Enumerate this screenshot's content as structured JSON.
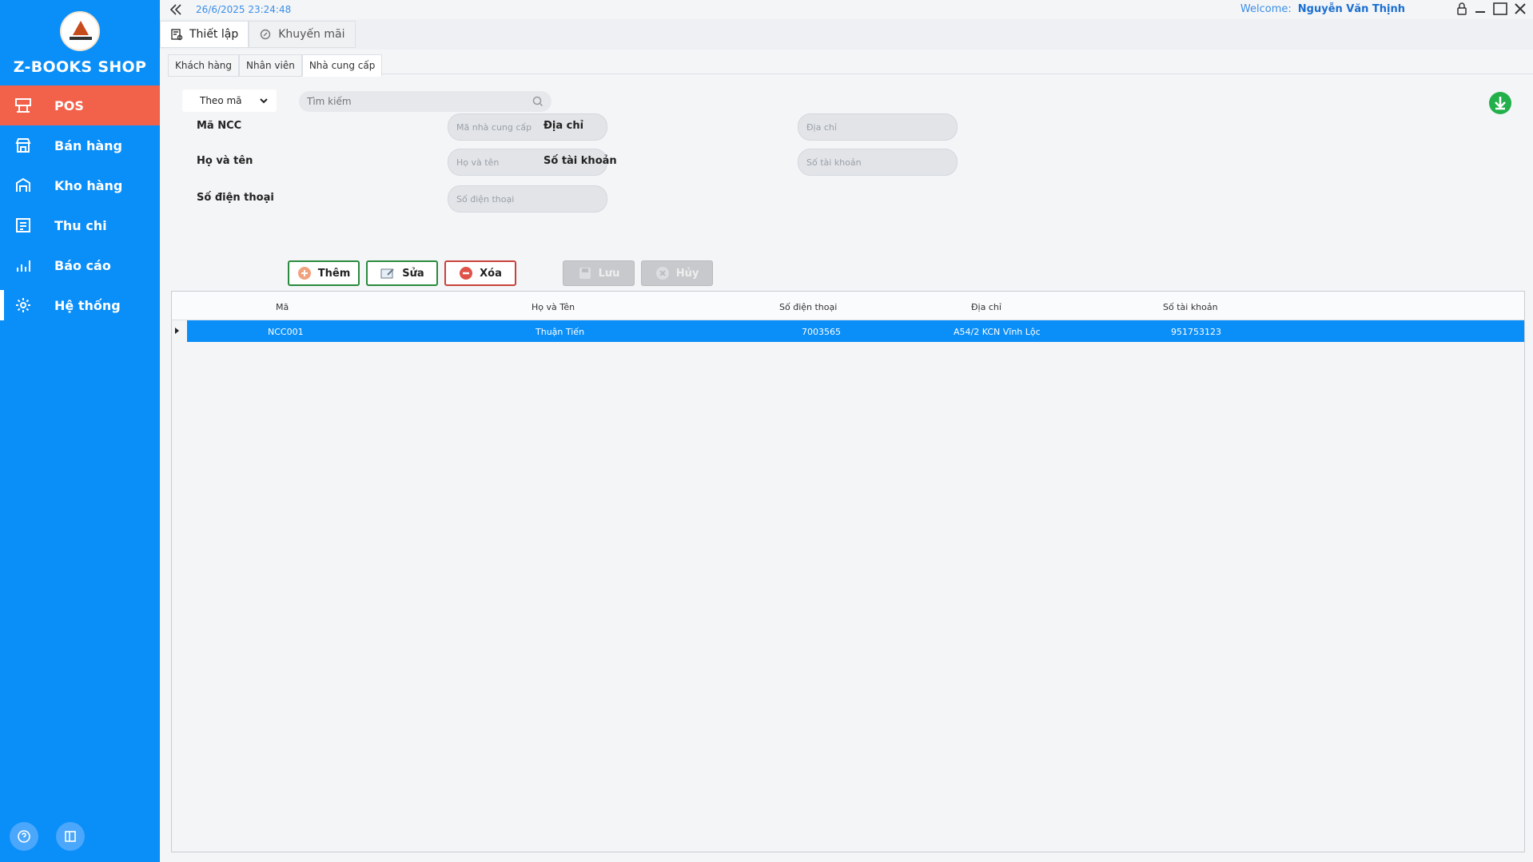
{
  "app": {
    "brand": "Z-BOOKS SHOP",
    "datetime": "26/6/2025 23:24:48",
    "welcome_label": "Welcome:",
    "user_name": "Nguyễn Văn Thịnh"
  },
  "sidebar": {
    "items": [
      {
        "label": "POS",
        "icon": "pos-icon"
      },
      {
        "label": "Bán hàng",
        "icon": "store-icon"
      },
      {
        "label": "Kho hàng",
        "icon": "warehouse-icon"
      },
      {
        "label": "Thu chi",
        "icon": "ledger-icon"
      },
      {
        "label": "Báo cáo",
        "icon": "chart-icon"
      },
      {
        "label": "Hệ thống",
        "icon": "gear-icon"
      }
    ]
  },
  "main_tabs": [
    {
      "label": "Thiết lập"
    },
    {
      "label": "Khuyến mãi"
    }
  ],
  "sub_tabs": [
    {
      "label": "Khách hàng"
    },
    {
      "label": "Nhân viên"
    },
    {
      "label": "Nhà cung cấp"
    }
  ],
  "filter": {
    "selected": "Theo mã",
    "search_placeholder": "Tìm kiếm"
  },
  "form": {
    "ma_ncc_label": "Mã NCC",
    "ma_ncc_placeholder": "Mã nhà cung cấp",
    "ho_ten_label": "Họ và tên",
    "ho_ten_placeholder": "Họ và tên",
    "sdt_label": "Số điện thoại",
    "sdt_placeholder": "Số điện thoại",
    "dia_chi_label": "Địa chỉ",
    "dia_chi_placeholder": "Địa chỉ",
    "stk_label": "Số tài khoản",
    "stk_placeholder": "Số tài khoản"
  },
  "actions": {
    "add": "Thêm",
    "edit": "Sửa",
    "delete": "Xóa",
    "save": "Lưu",
    "cancel": "Hủy"
  },
  "table": {
    "columns": [
      "Mã",
      "Họ và Tên",
      "Số điện thoại",
      "Địa chỉ",
      "Số tài khoản"
    ],
    "rows": [
      [
        "NCC001",
        "Thuận Tiến",
        "7003565",
        "A54/2 KCN Vĩnh Lộc",
        "951753123"
      ]
    ]
  },
  "colors": {
    "sidebar": "#0a8ef8",
    "active_nav": "#f2614a",
    "selected_row": "#0a8ef8"
  }
}
